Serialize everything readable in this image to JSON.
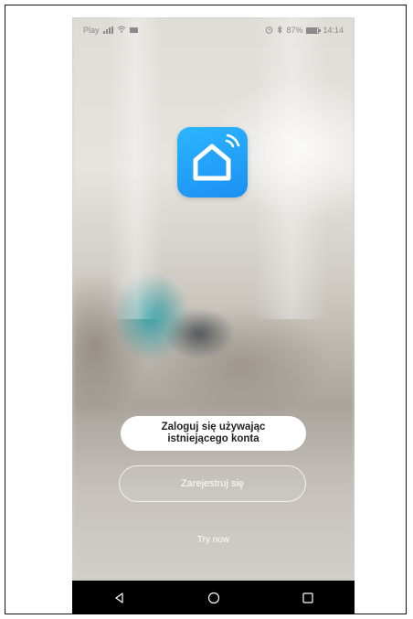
{
  "status_bar": {
    "carrier": "Play",
    "battery": "87%",
    "battery_level": 0.87,
    "time": "14:14",
    "icons": [
      "signal-icon",
      "wifi-icon",
      "mail-icon",
      "alarm-icon",
      "bluetooth-icon",
      "battery-icon"
    ]
  },
  "app": {
    "icon": "home-wifi-icon",
    "colors": {
      "icon_gradient_top": "#2bb6ff",
      "icon_gradient_bottom": "#1b8ff2"
    }
  },
  "actions": {
    "login_label": "Zaloguj się używając istniejącego konta",
    "register_label": "Zarejestruj się",
    "try_now_label": "Try now"
  },
  "nav_bar": {
    "icons": [
      "back-icon",
      "home-icon",
      "recents-icon"
    ]
  }
}
